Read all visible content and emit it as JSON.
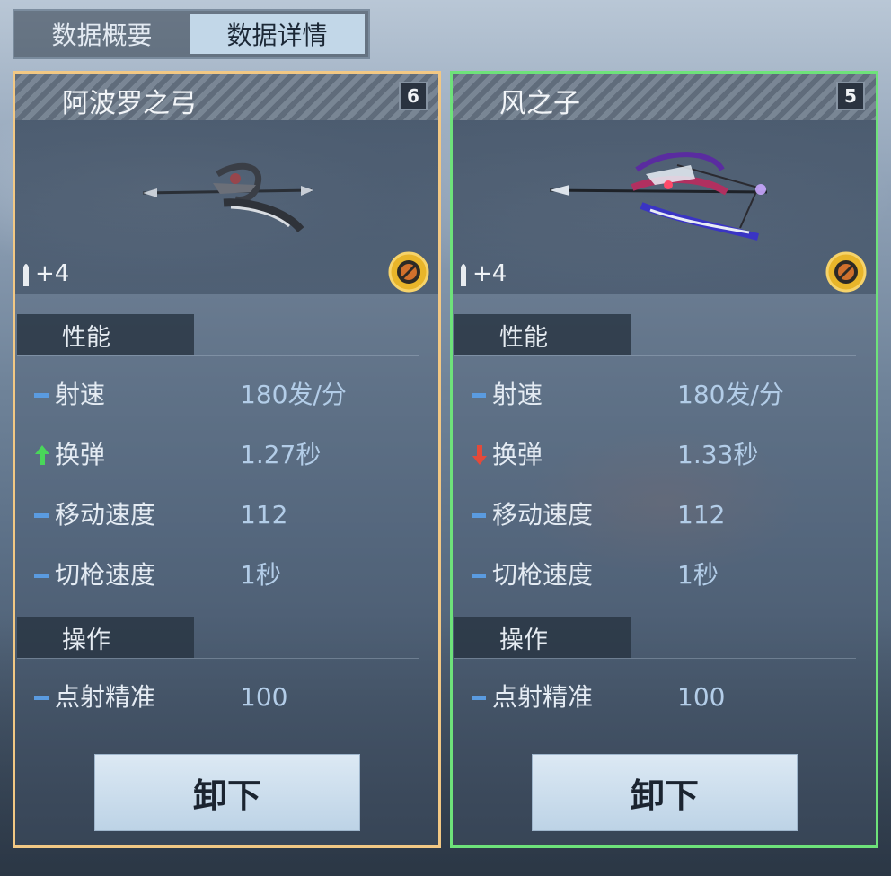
{
  "tabs": [
    {
      "label": "数据概要",
      "active": false
    },
    {
      "label": "数据详情",
      "active": true
    }
  ],
  "cards": [
    {
      "border_color": "#f2c884",
      "name": "阿波罗之弓",
      "level": "6",
      "ammo": "+4",
      "sections": {
        "performance": "性能",
        "operation": "操作"
      },
      "stats": [
        {
          "label": "射速",
          "value": "180发/分",
          "indicator": "neutral"
        },
        {
          "label": "换弹",
          "value": "1.27秒",
          "indicator": "up"
        },
        {
          "label": "移动速度",
          "value": "112",
          "indicator": "neutral"
        },
        {
          "label": "切枪速度",
          "value": "1秒",
          "indicator": "neutral"
        },
        {
          "label": "点射精准",
          "value": "100",
          "indicator": "neutral"
        }
      ],
      "button": "卸下"
    },
    {
      "border_color": "#6ee27a",
      "name": "风之子",
      "level": "5",
      "ammo": "+4",
      "sections": {
        "performance": "性能",
        "operation": "操作"
      },
      "stats": [
        {
          "label": "射速",
          "value": "180发/分",
          "indicator": "neutral"
        },
        {
          "label": "换弹",
          "value": "1.33秒",
          "indicator": "down"
        },
        {
          "label": "移动速度",
          "value": "112",
          "indicator": "neutral"
        },
        {
          "label": "切枪速度",
          "value": "1秒",
          "indicator": "neutral"
        },
        {
          "label": "点射精准",
          "value": "100",
          "indicator": "neutral"
        }
      ],
      "button": "卸下"
    }
  ],
  "indicator_colors": {
    "up": "#49d65a",
    "down": "#e34a3a",
    "neutral": "#5a9be0"
  },
  "icons": {
    "ammo": "bullet-icon",
    "class": "bow-class-icon"
  }
}
